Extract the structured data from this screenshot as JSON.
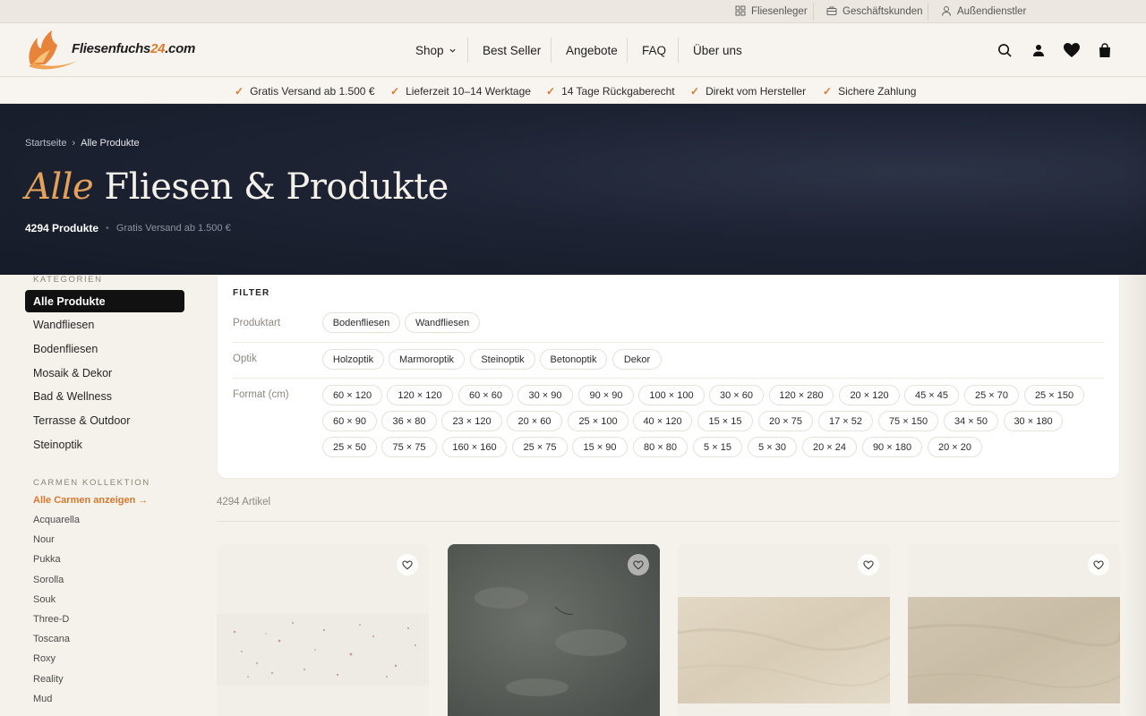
{
  "utility_bar": {
    "items": [
      {
        "label": "Fliesenleger",
        "icon": "grid-icon"
      },
      {
        "label": "Geschäftskunden",
        "icon": "briefcase-icon"
      },
      {
        "label": "Außendienstler",
        "icon": "user-icon"
      }
    ]
  },
  "header": {
    "logo": {
      "text_main": "Fliesenfuchs",
      "text_num": "24",
      "text_tld": ".com"
    },
    "nav": [
      {
        "label": "Shop"
      },
      {
        "label": "Best Seller"
      },
      {
        "label": "Angebote"
      },
      {
        "label": "FAQ"
      },
      {
        "label": "Über uns"
      }
    ],
    "icons": [
      "search-icon",
      "account-icon",
      "wishlist-heart-icon",
      "cart-bag-icon"
    ]
  },
  "trust_bar": [
    "Gratis Versand ab 1.500 €",
    "Lieferzeit 10–14 Werktage",
    "14 Tage Rückgaberecht",
    "Direkt vom Hersteller",
    "Sichere Zahlung"
  ],
  "hero": {
    "breadcrumb": {
      "home": "Startseite",
      "sep": "›",
      "current": "Alle Produkte"
    },
    "title_accent": "Alle",
    "title_rest": "Fliesen & Produkte",
    "product_count": "4294 Produkte",
    "dot": "•",
    "shipping_note": "Gratis Versand ab 1.500 €"
  },
  "sidebar": {
    "categories_heading": "KATEGORIEN",
    "categories": [
      {
        "label": "Alle Produkte",
        "active": true
      },
      {
        "label": "Wandfliesen"
      },
      {
        "label": "Bodenfliesen"
      },
      {
        "label": "Mosaik & Dekor"
      },
      {
        "label": "Bad & Wellness"
      },
      {
        "label": "Terrasse & Outdoor"
      },
      {
        "label": "Steinoptik"
      }
    ],
    "collection_heading": "CARMEN KOLLEKTION",
    "collection_link": "Alle Carmen anzeigen →",
    "collections": [
      "Acquarella",
      "Nour",
      "Pukka",
      "Sorolla",
      "Souk",
      "Three-D",
      "Toscana",
      "Roxy",
      "Reality",
      "Mud"
    ]
  },
  "filter": {
    "title": "FILTER",
    "rows": [
      {
        "label": "Produktart",
        "chips": [
          "Bodenfliesen",
          "Wandfliesen"
        ]
      },
      {
        "label": "Optik",
        "chips": [
          "Holzoptik",
          "Marmoroptik",
          "Steinoptik",
          "Betonoptik",
          "Dekor"
        ]
      },
      {
        "label": "Format (cm)",
        "chips": [
          "60 × 120",
          "120 × 120",
          "60 × 60",
          "30 × 90",
          "90 × 90",
          "100 × 100",
          "30 × 60",
          "120 × 280",
          "20 × 120",
          "45 × 45",
          "25 × 70",
          "25 × 150",
          "60 × 90",
          "36 × 80",
          "23 × 120",
          "20 × 60",
          "25 × 100",
          "40 × 120",
          "15 × 15",
          "20 × 75",
          "17 × 52",
          "75 × 150",
          "34 × 50",
          "30 × 180",
          "25 × 50",
          "75 × 75",
          "160 × 160",
          "25 × 75",
          "15 × 90",
          "80 × 80",
          "5 × 15",
          "5 × 30",
          "20 × 24",
          "90 × 180",
          "20 × 20"
        ]
      }
    ]
  },
  "results": {
    "count_label": "4294 Artikel"
  },
  "colors": {
    "accent": "#d9772b",
    "hero_bg": "#1d2333",
    "hero_accent": "#e4a15b",
    "page_bg": "#f5f2ec"
  }
}
